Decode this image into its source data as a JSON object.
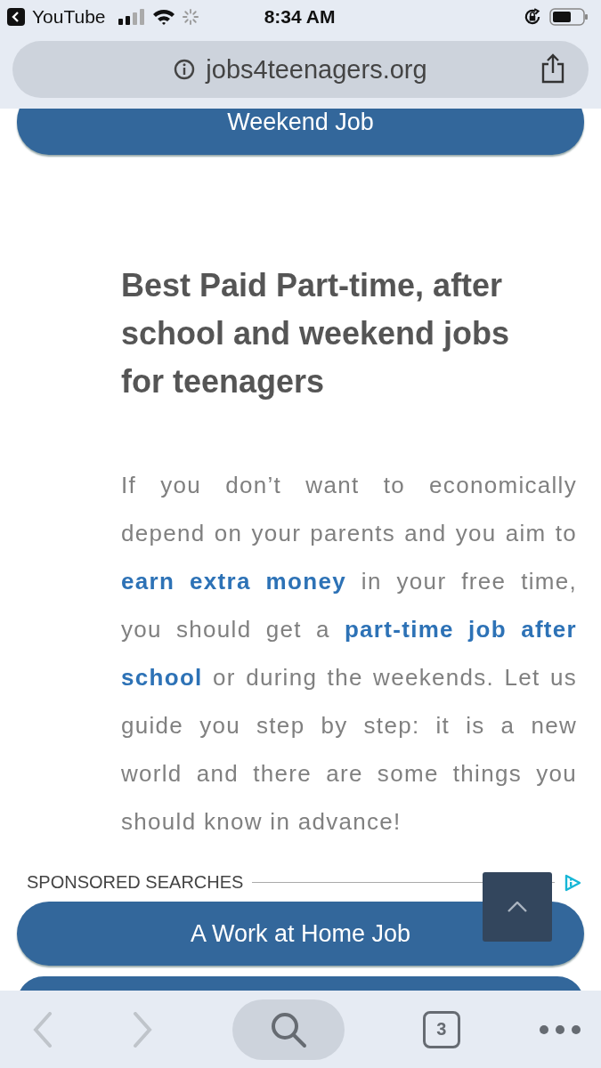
{
  "status_bar": {
    "back_app": "YouTube",
    "time": "8:34 AM"
  },
  "address_bar": {
    "url": "jobs4teenagers.org"
  },
  "top_button": "Weekend Job",
  "heading": "Best Paid Part-time, after school and weekend jobs for teenagers",
  "paragraph": [
    {
      "kind": "text",
      "text": "If you don’t want to economically depend on your parents and you aim to "
    },
    {
      "kind": "link",
      "text": "earn extra money"
    },
    {
      "kind": "text",
      "text": " in your free time, you should get a "
    },
    {
      "kind": "link_part",
      "text": "part-time job after"
    },
    {
      "kind": "link",
      "text": "school"
    },
    {
      "kind": "text",
      "text": " or during the weekends. Let us guide you step by step: it is a new world and there are some things you should know in advance!"
    }
  ],
  "sponsored": {
    "label": "SPONSORED SEARCHES",
    "buttons": [
      {
        "kind": "full",
        "label": "A Work at Home Job"
      },
      {
        "kind": "cut"
      }
    ]
  },
  "toolbar": {
    "tabs_count": "3"
  }
}
